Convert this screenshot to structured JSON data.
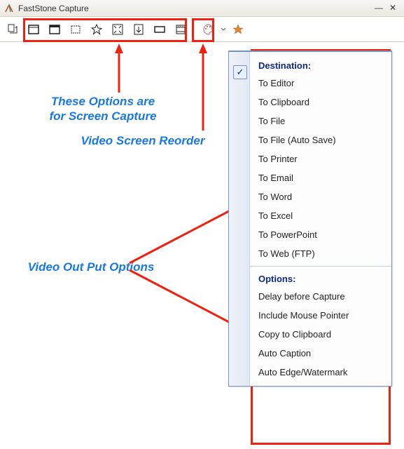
{
  "title": "FastStone Capture",
  "toolbar": {
    "icons": [
      "doc",
      "window",
      "frame",
      "region",
      "freehand",
      "fullscreen",
      "scroll",
      "fixed",
      "video",
      "palette",
      "finder"
    ]
  },
  "annotations": {
    "capture": "These Options are\nfor Screen Capture",
    "video": "Video Screen Reorder",
    "output": "Video Out Put Options"
  },
  "menu": {
    "header_dest": "Destination:",
    "dest_items": [
      "To Editor",
      "To Clipboard",
      "To File",
      "To File (Auto Save)",
      "To Printer",
      "To Email",
      "To Word",
      "To Excel",
      "To PowerPoint",
      "To Web (FTP)"
    ],
    "checked_index": 0,
    "header_options": "Options:",
    "option_items": [
      "Delay before Capture",
      "Include Mouse Pointer",
      "Copy to Clipboard",
      "Auto Caption",
      "Auto Edge/Watermark"
    ]
  }
}
